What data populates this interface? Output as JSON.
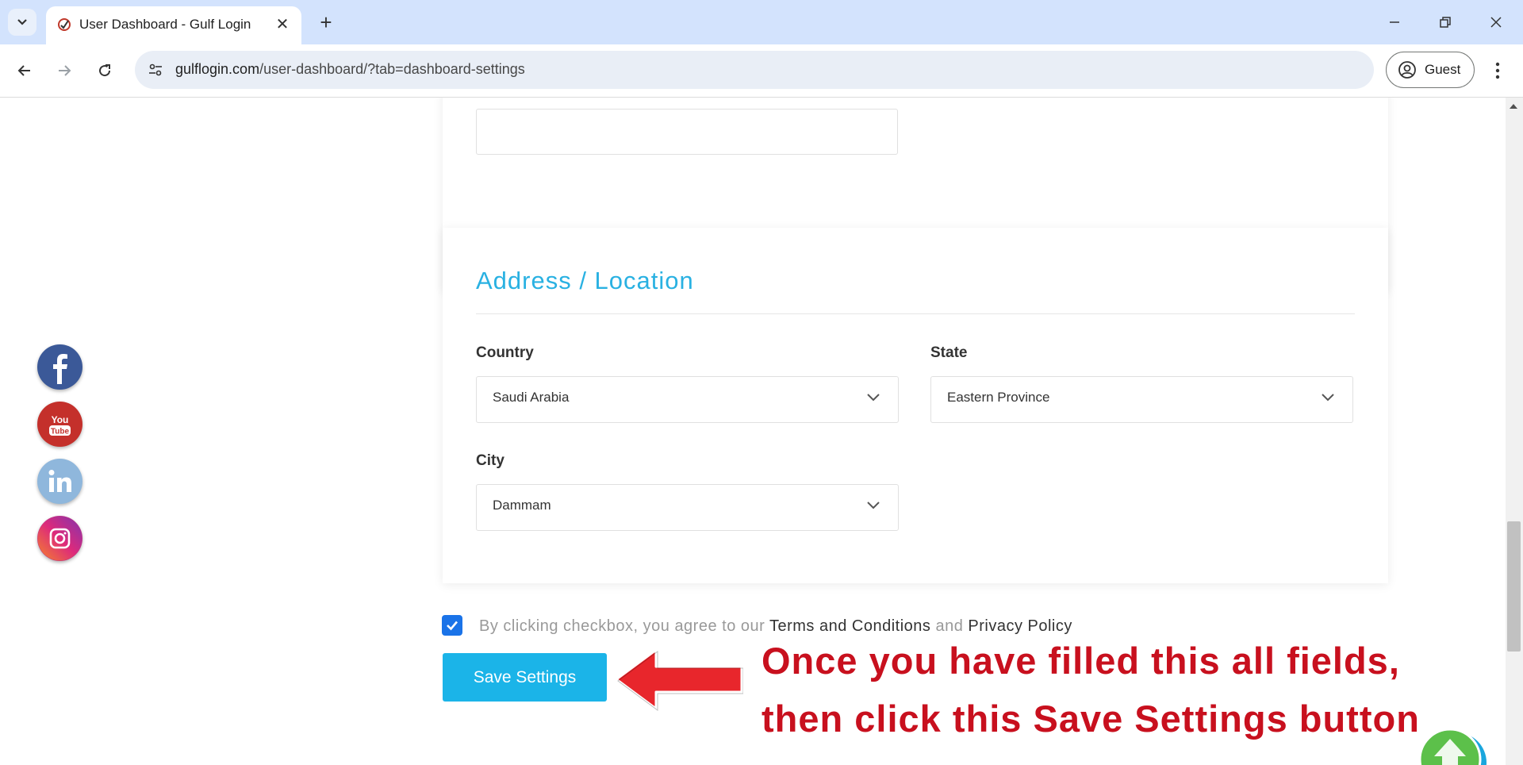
{
  "browser": {
    "tab_title": "User Dashboard - Gulf Login",
    "url_domain": "gulflogin.com",
    "url_path": "/user-dashboard/?tab=dashboard-settings",
    "profile_label": "Guest"
  },
  "address_section": {
    "title": "Address / Location",
    "country_label": "Country",
    "country_value": "Saudi Arabia",
    "state_label": "State",
    "state_value": "Eastern Province",
    "city_label": "City",
    "city_value": "Dammam"
  },
  "agreement": {
    "checked": true,
    "text_prefix": "By clicking checkbox, you agree to our ",
    "terms_link": "Terms and Conditions",
    "text_and": " and ",
    "privacy_link": "Privacy Policy"
  },
  "save_button_label": "Save Settings",
  "annotation": {
    "line1": "Once you have filled this all fields,",
    "line2": "then click this Save Settings button"
  },
  "social_icons": [
    "facebook-icon",
    "youtube-icon",
    "linkedin-icon",
    "instagram-icon"
  ],
  "colors": {
    "accent": "#29b1e2",
    "button": "#1bb4e8",
    "annotation_red": "#c8101e",
    "arrow_red": "#e8262c"
  }
}
